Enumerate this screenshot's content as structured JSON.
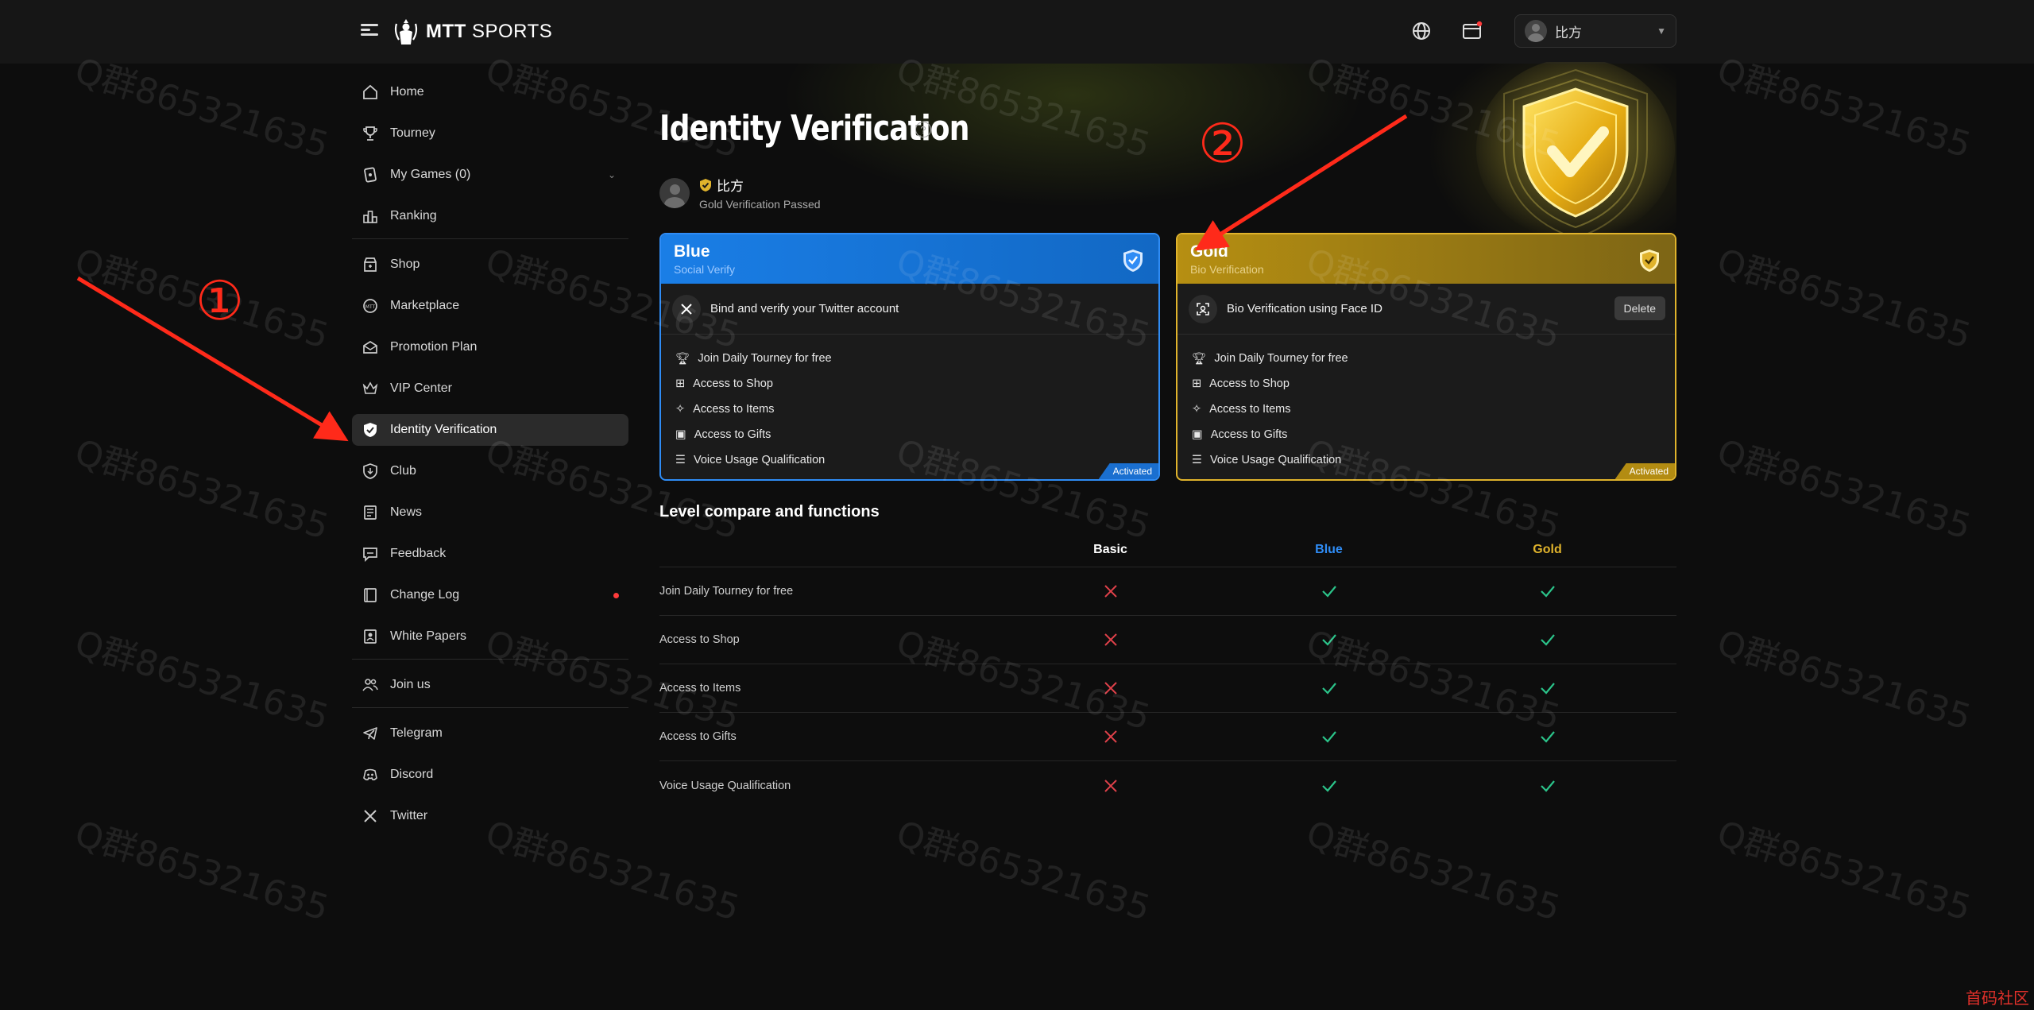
{
  "app": {
    "logo_bold": "MTT",
    "logo_thin": " SPORTS",
    "username": "比方"
  },
  "sidebar": {
    "items": [
      {
        "label": "Home"
      },
      {
        "label": "Tourney"
      },
      {
        "label": "My Games (0)"
      },
      {
        "label": "Ranking"
      },
      {
        "label": "Shop"
      },
      {
        "label": "Marketplace"
      },
      {
        "label": "Promotion Plan"
      },
      {
        "label": "VIP Center"
      },
      {
        "label": "Identity Verification"
      },
      {
        "label": "Club"
      },
      {
        "label": "News"
      },
      {
        "label": "Feedback"
      },
      {
        "label": "Change Log"
      },
      {
        "label": "White Papers"
      },
      {
        "label": "Join us"
      },
      {
        "label": "Telegram"
      },
      {
        "label": "Discord"
      },
      {
        "label": "Twitter"
      }
    ]
  },
  "page": {
    "title": "Identity Verification",
    "user_name": "比方",
    "user_status": "Gold Verification Passed"
  },
  "cards": {
    "blue": {
      "title": "Blue",
      "subtitle": "Social Verify",
      "verify_text": "Bind and verify your Twitter account",
      "features": [
        "Join Daily Tourney for free",
        "Access to Shop",
        "Access to Items",
        "Access to Gifts",
        "Voice Usage Qualification"
      ],
      "status": "Activated"
    },
    "gold": {
      "title": "Gold",
      "subtitle": "Bio Verification",
      "verify_text": "Bio Verification using Face ID",
      "delete_label": "Delete",
      "features": [
        "Join Daily Tourney for free",
        "Access to Shop",
        "Access to Items",
        "Access to Gifts",
        "Voice Usage Qualification"
      ],
      "status": "Activated"
    }
  },
  "compare": {
    "title": "Level compare and functions",
    "headers": [
      "Basic",
      "Blue",
      "Gold"
    ],
    "rows": [
      {
        "label": "Join Daily Tourney for free",
        "basic": false,
        "blue": true,
        "gold": true
      },
      {
        "label": "Access to Shop",
        "basic": false,
        "blue": true,
        "gold": true
      },
      {
        "label": "Access to Items",
        "basic": false,
        "blue": true,
        "gold": true
      },
      {
        "label": "Access to Gifts",
        "basic": false,
        "blue": true,
        "gold": true
      },
      {
        "label": "Voice Usage Qualification",
        "basic": false,
        "blue": true,
        "gold": true
      }
    ]
  },
  "annotations": {
    "one": "①",
    "two": "②"
  },
  "watermark": "Q群865321635",
  "corner_text": "首码社区",
  "colors": {
    "blue": "#2f8cf5",
    "gold": "#e0b32c",
    "check": "#2bc48a",
    "cross": "#e0414a",
    "arrow": "#ff2a1a"
  }
}
